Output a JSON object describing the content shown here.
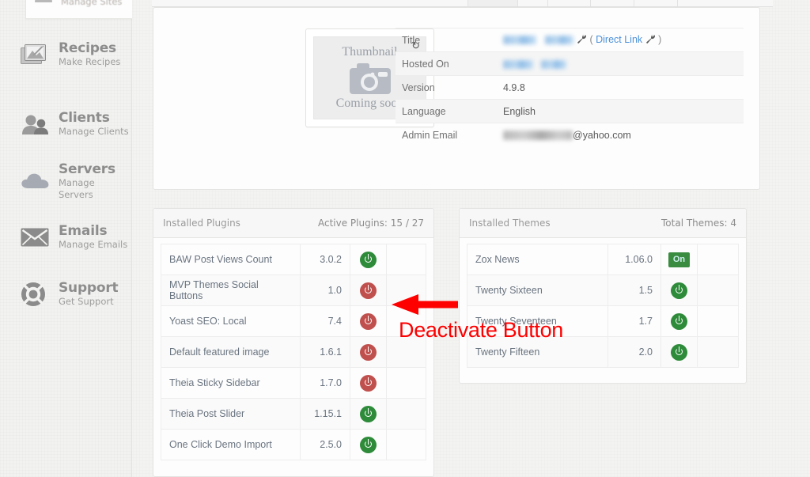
{
  "sidebar": {
    "clipped_item": {
      "label": "Manage Sites"
    },
    "items": [
      {
        "title": "Recipes",
        "subtitle": "Make Recipes",
        "icon": "image-stack-icon"
      },
      {
        "title": "Clients",
        "subtitle": "Manage Clients",
        "icon": "users-icon"
      },
      {
        "title": "Servers",
        "subtitle": "Manage Servers",
        "icon": "cloud-icon"
      },
      {
        "title": "Emails",
        "subtitle": "Manage Emails",
        "icon": "envelope-icon"
      },
      {
        "title": "Support",
        "subtitle": "Get Support",
        "icon": "lifebuoy-icon"
      }
    ]
  },
  "site_info": {
    "thumbnail": {
      "line1": "Thumbnail",
      "line2": "Coming soon",
      "refresh_icon": "refresh-icon"
    },
    "rows": [
      {
        "key": "Title",
        "value": "",
        "redacted": true,
        "link_label": "Direct Link",
        "open_paren": "(",
        "close_paren": ")"
      },
      {
        "key": "Hosted On",
        "value": "",
        "redacted": true
      },
      {
        "key": "Version",
        "value": "4.9.8",
        "redacted": false
      },
      {
        "key": "Language",
        "value": "English",
        "redacted": false
      },
      {
        "key": "Admin Email",
        "value": "@yahoo.com",
        "redacted": true
      }
    ]
  },
  "plugins_panel": {
    "title": "Installed Plugins",
    "count_label": "Active Plugins: 15 / 27",
    "rows": [
      {
        "name": "BAW Post Views Count",
        "version": "3.0.2",
        "state": "on"
      },
      {
        "name": "MVP Themes Social Buttons",
        "version": "1.0",
        "state": "off"
      },
      {
        "name": "Yoast SEO: Local",
        "version": "7.4",
        "state": "off"
      },
      {
        "name": "Default featured image",
        "version": "1.6.1",
        "state": "off"
      },
      {
        "name": "Theia Sticky Sidebar",
        "version": "1.7.0",
        "state": "off"
      },
      {
        "name": "Theia Post Slider",
        "version": "1.15.1",
        "state": "on"
      },
      {
        "name": "One Click Demo Import",
        "version": "2.5.0",
        "state": "on"
      }
    ]
  },
  "themes_panel": {
    "title": "Installed Themes",
    "count_label": "Total Themes: 4",
    "rows": [
      {
        "name": "Zox News",
        "version": "1.06.0",
        "state": "active",
        "badge": "On"
      },
      {
        "name": "Twenty Sixteen",
        "version": "1.5",
        "state": "on"
      },
      {
        "name": "Twenty Seventeen",
        "version": "1.7",
        "state": "on"
      },
      {
        "name": "Twenty Fifteen",
        "version": "2.0",
        "state": "on"
      }
    ]
  },
  "annotation": {
    "text": "Deactivate Button",
    "color": "#ff0000",
    "arrow": "left-arrow-icon"
  }
}
